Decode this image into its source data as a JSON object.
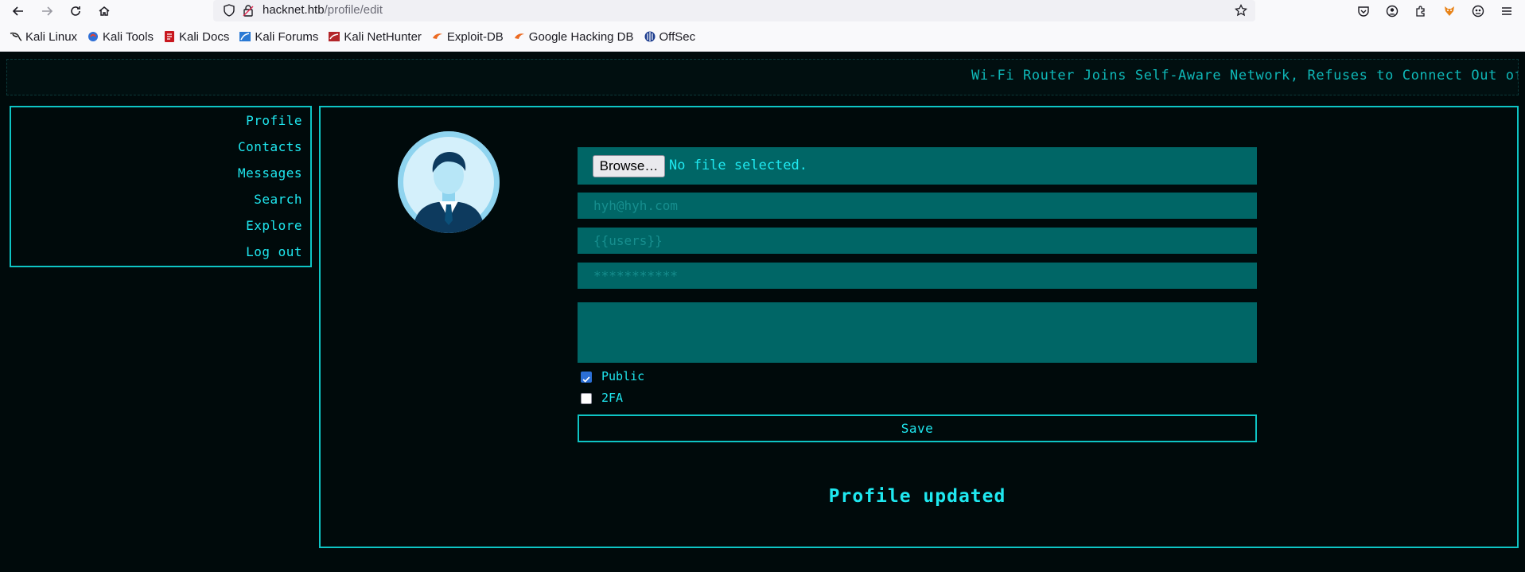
{
  "browser": {
    "url_host": "hacknet.htb",
    "url_path": "/profile/edit",
    "bookmarks": [
      {
        "label": "Kali Linux",
        "icon": "kali-dragon-icon"
      },
      {
        "label": "Kali Tools",
        "icon": "kali-tools-icon"
      },
      {
        "label": "Kali Docs",
        "icon": "kali-docs-icon"
      },
      {
        "label": "Kali Forums",
        "icon": "kali-forums-icon"
      },
      {
        "label": "Kali NetHunter",
        "icon": "kali-nethunter-icon"
      },
      {
        "label": "Exploit-DB",
        "icon": "exploit-db-icon"
      },
      {
        "label": "Google Hacking DB",
        "icon": "ghdb-icon"
      },
      {
        "label": "OffSec",
        "icon": "offsec-icon"
      }
    ]
  },
  "ticker": {
    "text": "Wi-Fi Router Joins Self-Aware Network, Refuses to Connect Out of"
  },
  "sidebar": {
    "items": [
      {
        "label": "Profile"
      },
      {
        "label": "Contacts"
      },
      {
        "label": "Messages"
      },
      {
        "label": "Search"
      },
      {
        "label": "Explore"
      },
      {
        "label": "Log out"
      }
    ]
  },
  "profile_form": {
    "avatar_icon": "businessman-avatar-icon",
    "browse_label": "Browse…",
    "file_status": "No file selected.",
    "email_placeholder": "hyh@hyh.com",
    "username_placeholder": "{{users}}",
    "password_placeholder": "***********",
    "public_label": "Public",
    "public_checked": true,
    "twofa_label": "2FA",
    "twofa_checked": false,
    "save_label": "Save",
    "status_message": "Profile updated"
  },
  "colors": {
    "page_bg": "#000a0b",
    "accent_cyan": "#1fe8f0",
    "border_cyan": "#0ec4c4",
    "input_bg": "#006666"
  }
}
